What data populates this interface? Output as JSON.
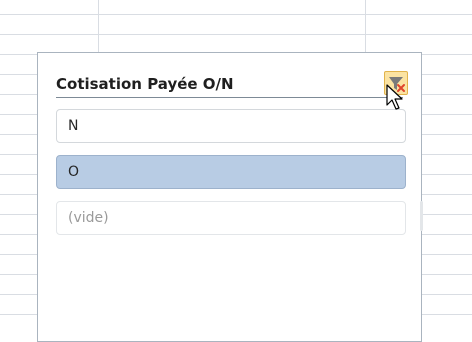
{
  "slicer": {
    "title": "Cotisation Payée O/N",
    "clear_filter_icon": "filter-clear-icon",
    "items": [
      {
        "label": "N",
        "selected": false
      },
      {
        "label": "O",
        "selected": true
      },
      {
        "label": "(vide)",
        "selected": false,
        "empty": true
      }
    ]
  },
  "colors": {
    "selected_item": "#b8cce4",
    "clear_button_bg": "#fbe3a2",
    "clear_icon_x": "#e0452d",
    "grid": "#d9dde3"
  },
  "cursor_icon": "arrow-pointer-icon"
}
